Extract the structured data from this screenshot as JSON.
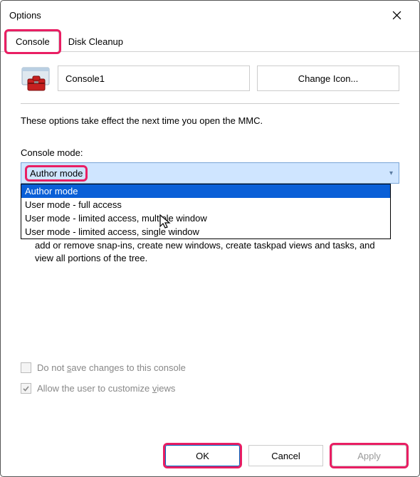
{
  "title": "Options",
  "tabs": {
    "console": "Console",
    "disk_cleanup": "Disk Cleanup"
  },
  "console_name": "Console1",
  "change_icon_label": "Change Icon...",
  "intro_text": "These options take effect the next time you open the MMC.",
  "console_mode_label": "Console mode:",
  "console_mode_value": "Author mode",
  "options": {
    "author": "Author mode",
    "full": "User mode - full access",
    "limited_multi": "User mode - limited access, multiple window",
    "limited_single": "User mode - limited access, single window"
  },
  "description_text": "add or remove snap-ins, create new windows, create taskpad views and tasks, and view all portions of the tree.",
  "checkbox1_pre": "Do not ",
  "checkbox1_u": "s",
  "checkbox1_post": "ave changes to this console",
  "checkbox2_pre": "Allow the user to customize ",
  "checkbox2_u": "v",
  "checkbox2_post": "iews",
  "buttons": {
    "ok": "OK",
    "cancel": "Cancel",
    "apply": "Apply"
  }
}
